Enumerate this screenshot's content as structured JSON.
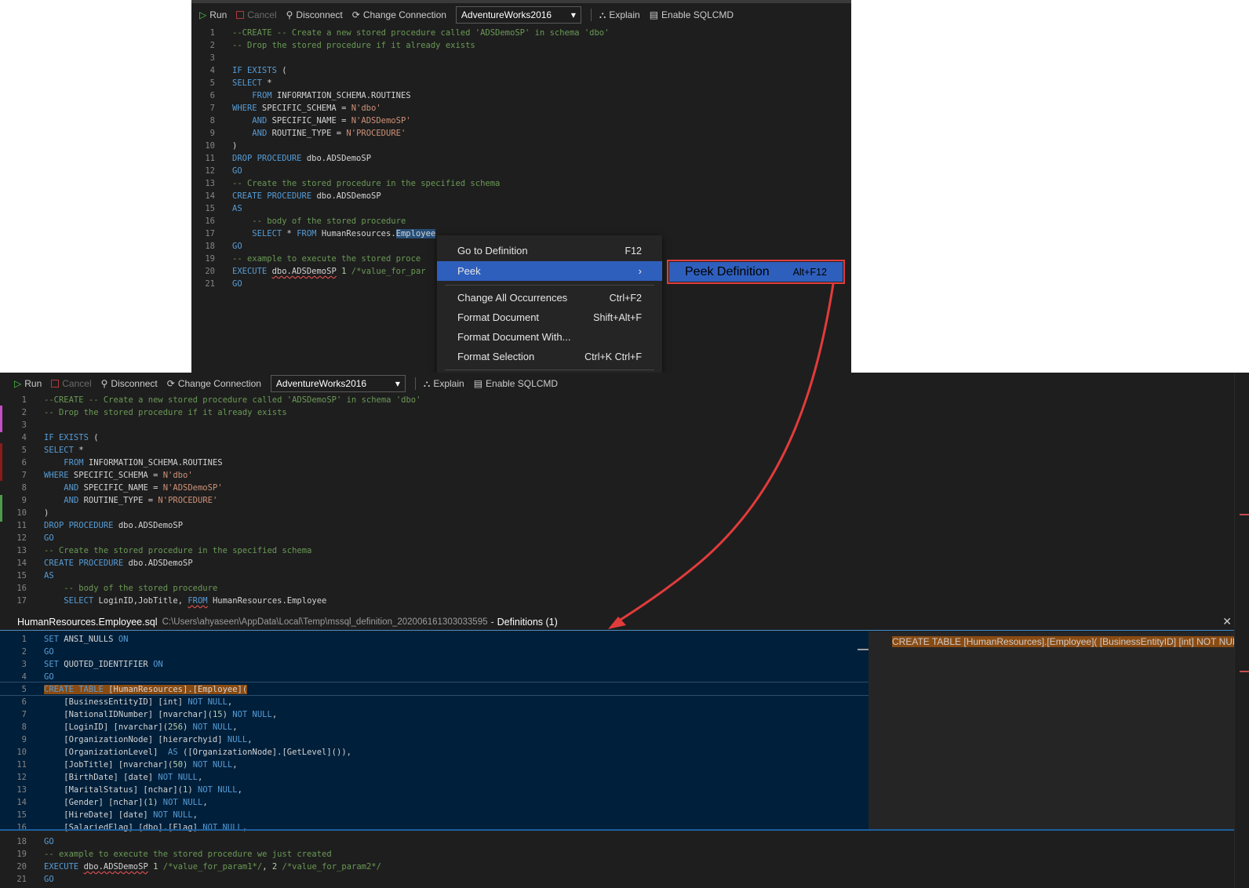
{
  "toolbar": {
    "run": "Run",
    "cancel": "Cancel",
    "disconnect": "Disconnect",
    "change_connection": "Change Connection",
    "database": "AdventureWorks2016",
    "explain": "Explain",
    "enable_sqlcmd": "Enable SQLCMD"
  },
  "top_editor": {
    "lines": [
      "1",
      "2",
      "3",
      "4",
      "5",
      "6",
      "7",
      "8",
      "9",
      "10",
      "11",
      "12",
      "13",
      "14",
      "15",
      "16",
      "17",
      "18",
      "19",
      "20",
      "21"
    ]
  },
  "context_menu": {
    "go_to_definition": "Go to Definition",
    "go_to_definition_key": "F12",
    "peek": "Peek",
    "change_all": "Change All Occurrences",
    "change_all_key": "Ctrl+F2",
    "format_document": "Format Document",
    "format_document_key": "Shift+Alt+F",
    "format_document_with": "Format Document With...",
    "format_selection": "Format Selection",
    "format_selection_key": "Ctrl+K Ctrl+F",
    "submenu_peek_definition": "Peek Definition",
    "submenu_peek_definition_key": "Alt+F12"
  },
  "peek": {
    "file_name": "HumanResources.Employee.sql",
    "file_path": "C:\\Users\\ahyaseen\\AppData\\Local\\Temp\\mssql_definition_202006161303033595",
    "separator": "-",
    "definitions": "Definitions (1)",
    "reference": "CREATE TABLE [HumanResources].[Employee]( [BusinessEntityID] [int] NOT NULL,"
  }
}
